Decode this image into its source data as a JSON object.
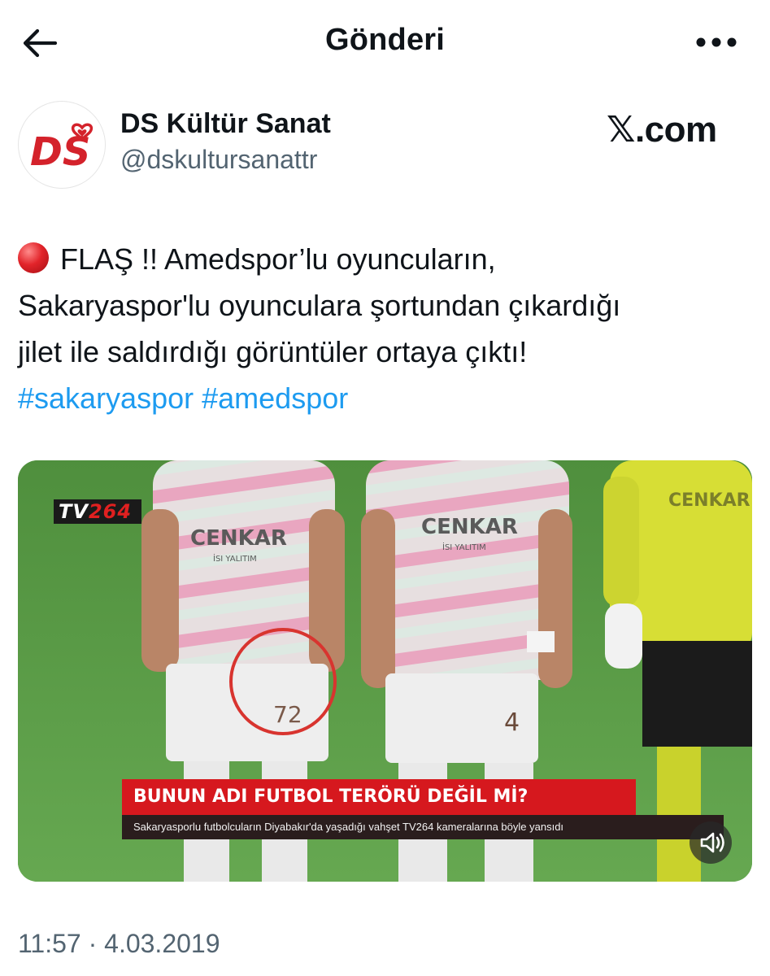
{
  "header": {
    "title": "Gönderi",
    "back_icon": "arrow-left-icon",
    "more_icon": "more-horizontal-icon"
  },
  "author": {
    "name": "DS Kültür Sanat",
    "handle": "@dskultursanattr",
    "avatar_text": "DS"
  },
  "watermark": "𝕏.com",
  "tweet": {
    "lines": [
      "FLAŞ !! Amedspor’lu oyuncuların,",
      "Sakaryaspor'lu oyunculara şortundan çıkardığı",
      "jilet ile saldırdığı görüntüler ortaya çıktı!"
    ],
    "emoji_icon": "red-circle-icon",
    "hashtags": [
      "#sakaryaspor",
      "#amedspor"
    ]
  },
  "media": {
    "channel_logo_prefix": "TV",
    "channel_logo_number": "264",
    "jersey_sponsor": "CENKAR",
    "jersey_sponsor_sub": "İSI YALITIM",
    "shirt_number_1": "72",
    "shirt_number_2": "4",
    "headline": "BUNUN ADI FUTBOL TERÖRÜ DEĞİL Mİ?",
    "subline": "Sakaryasporlu futbolcuların Diyabakır'da yaşadığı vahşet TV264 kameralarına böyle yansıdı",
    "sound_icon": "speaker-muted-icon"
  },
  "timestamp": "11:57 · 4.03.2019",
  "colors": {
    "link": "#1d9bf0",
    "muted_text": "#536471",
    "headline_red": "#d6181e",
    "pitch_green": "#5a9b46"
  }
}
